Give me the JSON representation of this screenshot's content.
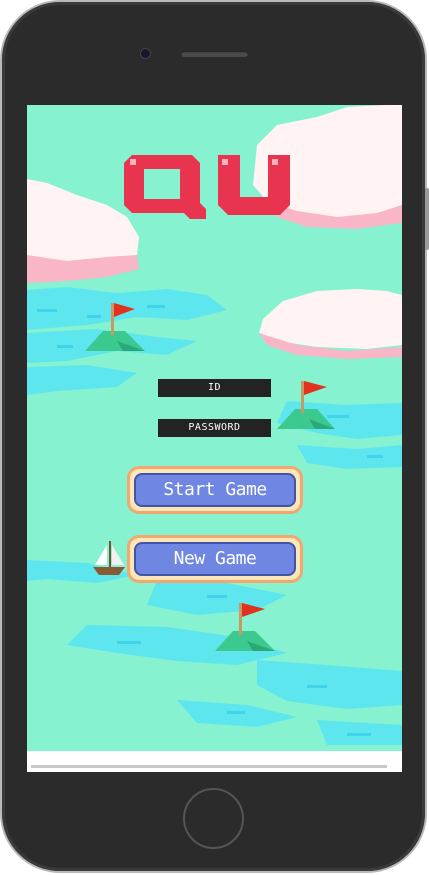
{
  "game": {
    "title": "QU",
    "id_field": {
      "placeholder": "ID"
    },
    "password_field": {
      "placeholder": "PASSWORD"
    },
    "start_button": {
      "label": "Start Game"
    },
    "new_button": {
      "label": "New Game"
    }
  },
  "colors": {
    "sky": "#86f2cf",
    "water": "#5ee6ef",
    "cloud_white": "#fff3f3",
    "cloud_pink": "#f8b6c6",
    "logo_red": "#e8344f",
    "island_green": "#3cc98f",
    "flag_red": "#e0321c",
    "button_blue": "#6f86e3",
    "button_frame": "#f2a76f"
  }
}
